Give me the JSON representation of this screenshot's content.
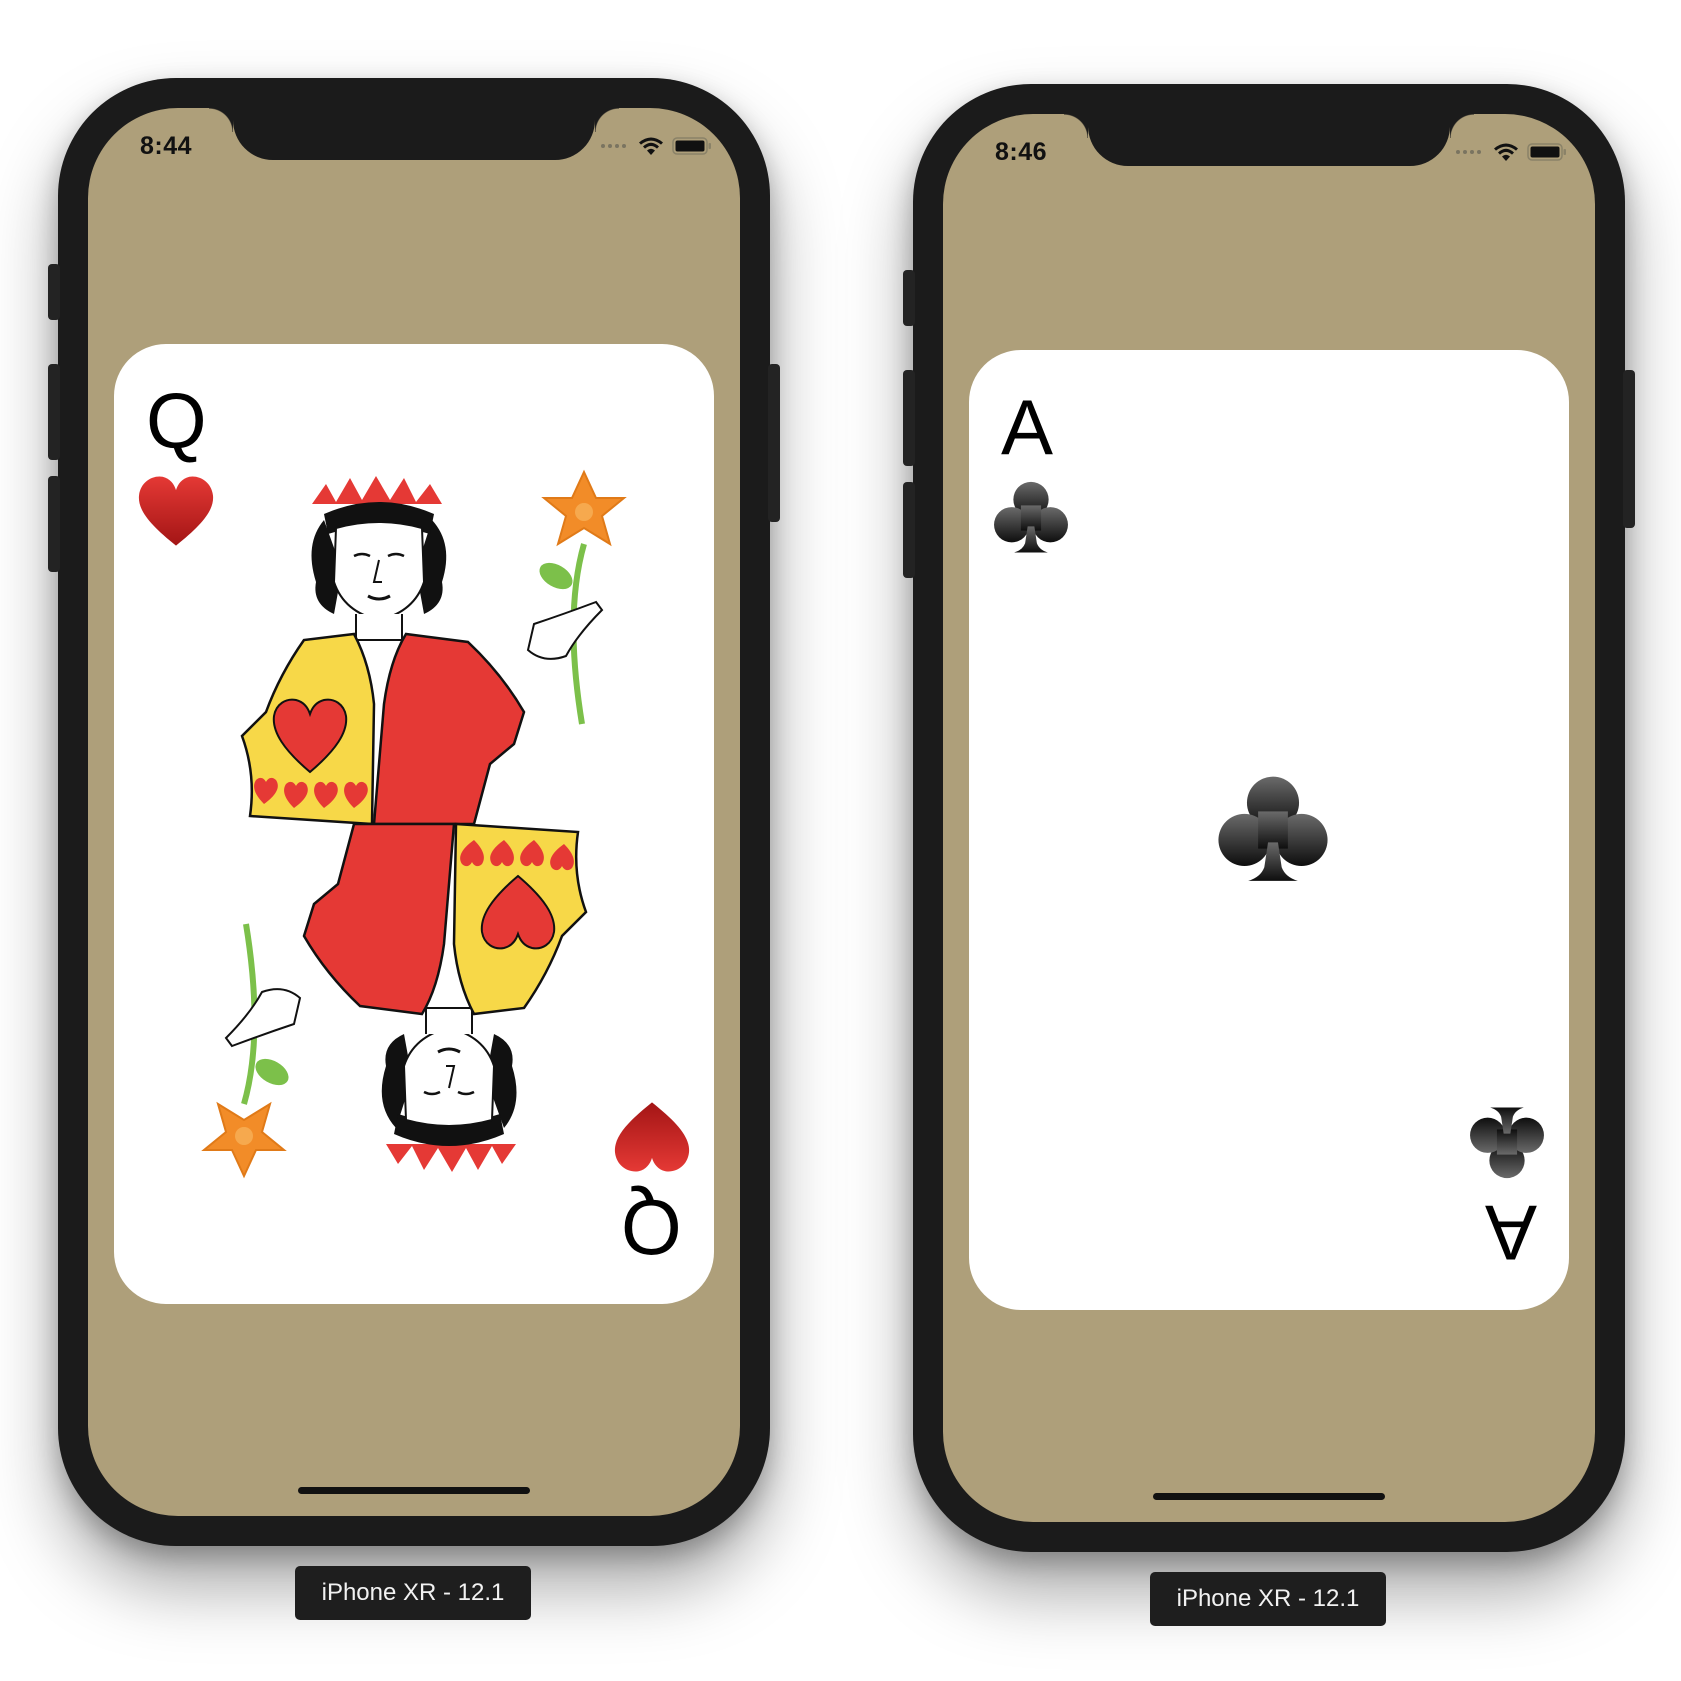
{
  "devices": [
    {
      "label": "iPhone XR - 12.1",
      "status_time": "8:44",
      "screen_color": "#ae9f7a",
      "card": {
        "rank": "Q",
        "suit": "hearts",
        "suit_icon": "heart-icon",
        "suit_color": "#c62828",
        "face_card": true
      }
    },
    {
      "label": "iPhone XR - 12.1",
      "status_time": "8:46",
      "screen_color": "#ae9f7a",
      "card": {
        "rank": "A",
        "suit": "clubs",
        "suit_icon": "club-icon",
        "suit_color": "#1a1a1a",
        "face_card": false
      }
    }
  ]
}
